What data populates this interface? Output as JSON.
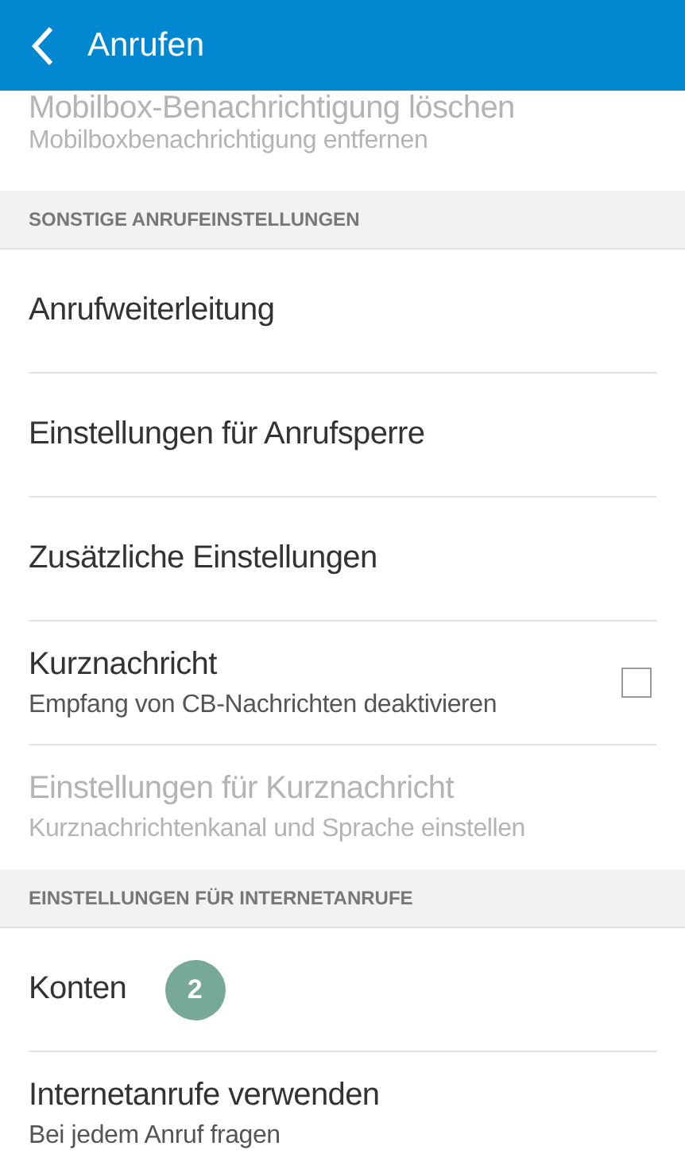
{
  "header": {
    "title": "Anrufen"
  },
  "rows": [
    {
      "kind": "item",
      "title": "Mobilbox-Benachrichtigung löschen",
      "subtitle": "Mobilboxbenachrichtigung entfernen",
      "disabled": true
    },
    {
      "kind": "section",
      "title": "SONSTIGE ANRUFEINSTELLUNGEN"
    },
    {
      "kind": "item",
      "title": "Anrufweiterleitung",
      "disabled": false
    },
    {
      "kind": "item",
      "title": "Einstellungen für Anrufsperre",
      "disabled": false
    },
    {
      "kind": "item",
      "title": "Zusätzliche Einstellungen",
      "disabled": false
    },
    {
      "kind": "item",
      "title": "Kurznachricht",
      "subtitle": "Empfang von CB-Nachrichten deaktivieren",
      "disabled": false,
      "checked": false
    },
    {
      "kind": "item",
      "title": "Einstellungen für Kurznachricht",
      "subtitle": "Kurznachrichtenkanal und Sprache einstellen",
      "disabled": true
    },
    {
      "kind": "section",
      "title": "EINSTELLUNGEN FÜR INTERNETANRUFE"
    },
    {
      "kind": "item",
      "title": "Konten",
      "badge": "2",
      "disabled": false
    },
    {
      "kind": "item",
      "title": "Internetanrufe verwenden",
      "subtitle": "Bei jedem Anruf fragen",
      "disabled": false
    }
  ]
}
